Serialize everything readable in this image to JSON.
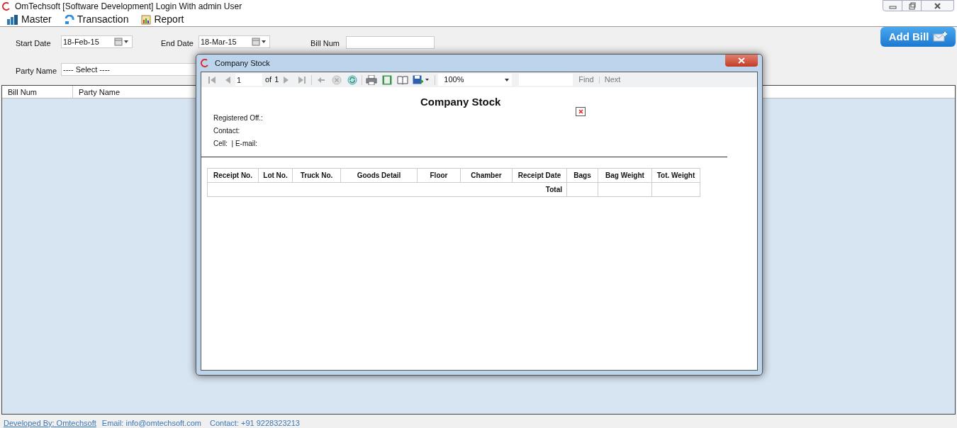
{
  "window": {
    "title": "OmTechsoft [Software Development] Login With admin User"
  },
  "menu": [
    {
      "label": "Master"
    },
    {
      "label": "Transaction"
    },
    {
      "label": "Report"
    }
  ],
  "filters": {
    "start_date": {
      "label": "Start Date",
      "value": "18-Feb-15"
    },
    "end_date": {
      "label": "End Date",
      "value": "18-Mar-15"
    },
    "bill_num": {
      "label": "Bill Num"
    },
    "party_name": {
      "label": "Party Name",
      "value": "---- Select ----"
    }
  },
  "add_button": "Add Bill",
  "grid": {
    "columns": [
      "Bill Num",
      "Party Name"
    ]
  },
  "dialog": {
    "title": "Company Stock",
    "toolbar": {
      "page": "1",
      "of_label": "of",
      "page_count": "1",
      "zoom": "100%",
      "find": "Find",
      "next": "Next"
    },
    "report": {
      "title": "Company Stock",
      "info": [
        "Registered Off.:",
        "Contact:",
        "Cell:  | E-mail:"
      ],
      "columns": [
        "Receipt No.",
        "Lot No.",
        "Truck No.",
        "Goods Detail",
        "Floor",
        "Chamber",
        "Receipt Date",
        "Bags",
        "Bag Weight",
        "Tot. Weight"
      ],
      "total_label": "Total"
    }
  },
  "status_bar": {
    "developer": "Developed By: Omtechsoft",
    "email": "Email: info@omtechsoft.com",
    "contact": "Contact: +91 9228323213"
  }
}
